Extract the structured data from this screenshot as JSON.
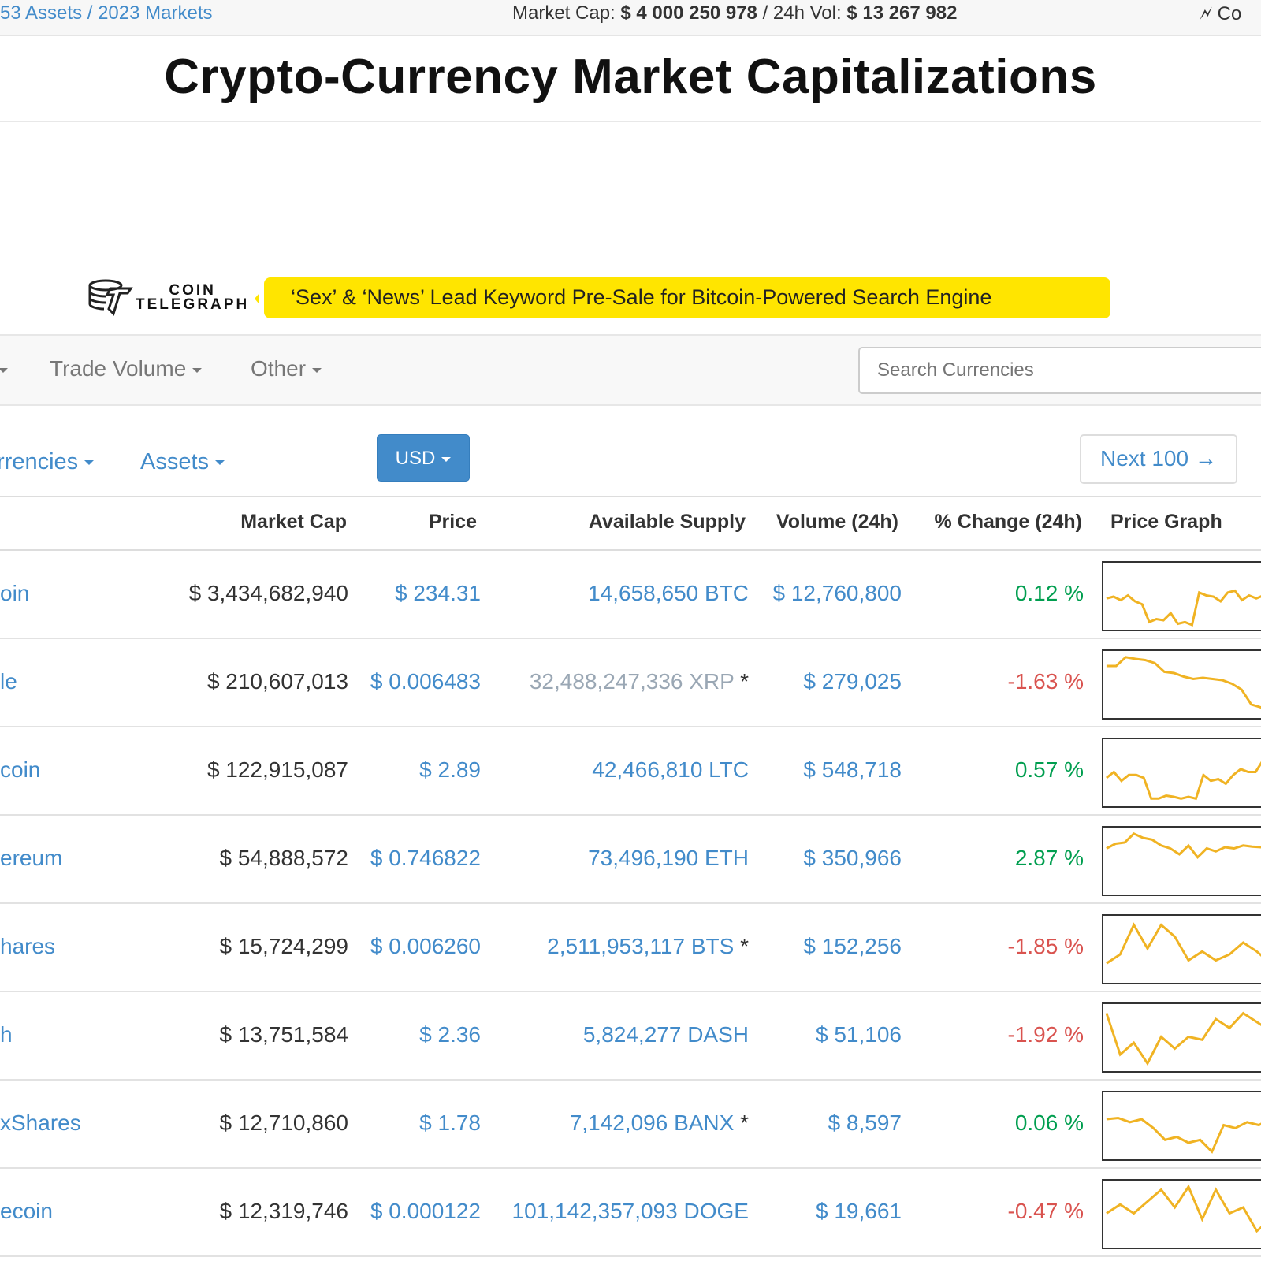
{
  "topbar": {
    "assets": "53 Assets",
    "separator": "/",
    "markets": "2023 Markets",
    "market_cap_label": "Market Cap:",
    "market_cap": "$ 4 000 250 978",
    "vol_sep": "/",
    "vol_label": "24h Vol:",
    "volume": "$ 13 267 982",
    "partner_text": "Co"
  },
  "page_title": "Crypto-Currency Market Capitalizations",
  "coin_telegraph": {
    "logo_text_1": "COIN",
    "logo_text_2": "TELEGRAPH",
    "headline": "‘Sex’ & ‘News’ Lead Keyword Pre-Sale for Bitcoin-Powered Search Engine"
  },
  "nav": {
    "items": [
      {
        "label": ""
      },
      {
        "label": "Trade Volume"
      },
      {
        "label": "Other"
      }
    ],
    "search_placeholder": "Search Currencies"
  },
  "subnav": {
    "currencies": "rrencies",
    "assets": "Assets",
    "currency_button": "USD",
    "next_button": "Next 100 →"
  },
  "table": {
    "headers": [
      "Market Cap",
      "Price",
      "Available Supply",
      "Volume (24h)",
      "% Change (24h)",
      "Price Graph"
    ],
    "rows": [
      {
        "name": "oin",
        "market_cap": "$ 3,434,682,940",
        "price": "$ 234.31",
        "supply": "14,658,650 BTC",
        "supply_muted": false,
        "volume": "$ 12,760,800",
        "change": "0.12 %",
        "positive": true,
        "graph": [
          0.55,
          0.52,
          0.58,
          0.5,
          0.6,
          0.65,
          0.95,
          0.9,
          0.92,
          0.8,
          0.98,
          0.95,
          1.0,
          0.45,
          0.5,
          0.52,
          0.6,
          0.45,
          0.42,
          0.58,
          0.5,
          0.55,
          0.5,
          0.3
        ]
      },
      {
        "name": "le",
        "market_cap": "$ 210,607,013",
        "price": "$ 0.006483",
        "supply": "32,488,247,336 XRP",
        "supply_muted": true,
        "asterisk": "*",
        "volume": "$ 279,025",
        "change": "-1.63 %",
        "positive": false,
        "graph": [
          0.2,
          0.2,
          0.05,
          0.08,
          0.1,
          0.15,
          0.3,
          0.32,
          0.38,
          0.42,
          0.4,
          0.42,
          0.44,
          0.5,
          0.6,
          0.85,
          0.9,
          0.92
        ]
      },
      {
        "name": "coin",
        "market_cap": "$ 122,915,087",
        "price": "$ 2.89",
        "supply": "42,466,810 LTC",
        "supply_muted": false,
        "volume": "$ 548,718",
        "change": "0.57 %",
        "positive": true,
        "graph": [
          0.6,
          0.5,
          0.65,
          0.55,
          0.55,
          0.6,
          0.95,
          0.95,
          0.9,
          0.92,
          0.95,
          0.92,
          0.95,
          0.55,
          0.65,
          0.62,
          0.7,
          0.55,
          0.45,
          0.5,
          0.5,
          0.3,
          0.4
        ]
      },
      {
        "name": "ereum",
        "market_cap": "$ 54,888,572",
        "price": "$ 0.746822",
        "supply": "73,496,190 ETH",
        "supply_muted": false,
        "volume": "$ 350,966",
        "change": "2.87 %",
        "positive": true,
        "graph": [
          0.3,
          0.22,
          0.2,
          0.05,
          0.12,
          0.15,
          0.25,
          0.3,
          0.4,
          0.25,
          0.45,
          0.3,
          0.35,
          0.28,
          0.3,
          0.25,
          0.27,
          0.28,
          0.24
        ]
      },
      {
        "name": "hares",
        "market_cap": "$ 15,724,299",
        "price": "$ 0.006260",
        "supply": "2,511,953,117 BTS",
        "supply_muted": false,
        "asterisk": "*",
        "volume": "$ 152,256",
        "change": "-1.85 %",
        "positive": false,
        "graph": [
          0.75,
          0.6,
          0.1,
          0.5,
          0.1,
          0.3,
          0.7,
          0.55,
          0.7,
          0.6,
          0.4,
          0.55,
          0.75
        ]
      },
      {
        "name": "h",
        "market_cap": "$ 13,751,584",
        "price": "$ 2.36",
        "supply": "5,824,277 DASH",
        "supply_muted": false,
        "volume": "$ 51,106",
        "change": "-1.92 %",
        "positive": false,
        "graph": [
          0.1,
          0.8,
          0.6,
          0.95,
          0.5,
          0.7,
          0.5,
          0.55,
          0.2,
          0.35,
          0.1,
          0.25,
          0.4
        ]
      },
      {
        "name": "xShares",
        "market_cap": "$ 12,710,860",
        "price": "$ 1.78",
        "supply": "7,142,096 BANX",
        "supply_muted": false,
        "asterisk": "*",
        "volume": "$ 8,597",
        "change": "0.06 %",
        "positive": true,
        "graph": [
          0.4,
          0.38,
          0.45,
          0.4,
          0.55,
          0.75,
          0.7,
          0.8,
          0.75,
          0.95,
          0.5,
          0.55,
          0.45,
          0.5,
          0.4
        ]
      },
      {
        "name": "ecoin",
        "market_cap": "$ 12,319,746",
        "price": "$ 0.000122",
        "supply": "101,142,357,093 DOGE",
        "supply_muted": false,
        "volume": "$ 19,661",
        "change": "-0.47 %",
        "positive": false,
        "graph": [
          0.5,
          0.35,
          0.5,
          0.3,
          0.1,
          0.4,
          0.05,
          0.6,
          0.1,
          0.5,
          0.4,
          0.8,
          0.6
        ]
      }
    ]
  },
  "colors": {
    "link": "#428bca",
    "positive": "#009e4f",
    "negative": "#d9534f",
    "muted": "#9aa7b4",
    "sparkline": "#f0b323",
    "banner": "#ffe500"
  }
}
